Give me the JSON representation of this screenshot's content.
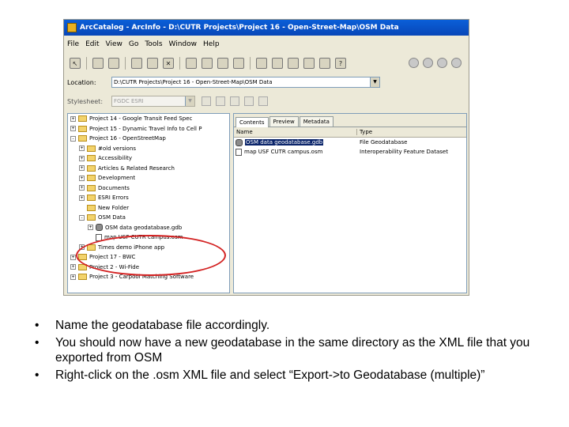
{
  "window": {
    "title": "ArcCatalog - ArcInfo - D:\\CUTR Projects\\Project 16 - Open-Street-Map\\OSM Data"
  },
  "menu": [
    "File",
    "Edit",
    "View",
    "Go",
    "Tools",
    "Window",
    "Help"
  ],
  "location": {
    "label": "Location:",
    "value": "D:\\CUTR Projects\\Project 16 - Open-Street-Map\\OSM Data"
  },
  "stylesheet": {
    "label": "Stylesheet:",
    "value": "FGDC ESRI"
  },
  "tree": [
    {
      "expander": "+",
      "icon": "folder",
      "label": "Project 14 - Google Transit Feed Spec",
      "indent": 0
    },
    {
      "expander": "+",
      "icon": "folder",
      "label": "Project 15 - Dynamic Travel Info to Cell P",
      "indent": 0
    },
    {
      "expander": "-",
      "icon": "folder",
      "label": "Project 16 - OpenStreetMap",
      "indent": 0
    },
    {
      "expander": "+",
      "icon": "folder",
      "label": "#old versions",
      "indent": 1
    },
    {
      "expander": "+",
      "icon": "folder",
      "label": "Accessibility",
      "indent": 1
    },
    {
      "expander": "+",
      "icon": "folder",
      "label": "Articles & Related Research",
      "indent": 1
    },
    {
      "expander": "+",
      "icon": "folder",
      "label": "Development",
      "indent": 1
    },
    {
      "expander": "+",
      "icon": "folder",
      "label": "Documents",
      "indent": 1
    },
    {
      "expander": "+",
      "icon": "folder",
      "label": "ESRI Errors",
      "indent": 1
    },
    {
      "expander": "",
      "icon": "folder",
      "label": "New Folder",
      "indent": 1
    },
    {
      "expander": "-",
      "icon": "folder",
      "label": "OSM Data",
      "indent": 1
    },
    {
      "expander": "+",
      "icon": "gdb",
      "label": "OSM data geodatabase.gdb",
      "indent": 2
    },
    {
      "expander": "",
      "icon": "osm",
      "label": "map USF CUTR campus.osm",
      "indent": 2
    },
    {
      "expander": "+",
      "icon": "folder",
      "label": "Times demo iPhone app",
      "indent": 1
    },
    {
      "expander": "+",
      "icon": "folder",
      "label": "Project 17 - BWC",
      "indent": 0
    },
    {
      "expander": "+",
      "icon": "folder",
      "label": "Project 2 - Wi-Fide",
      "indent": 0
    },
    {
      "expander": "+",
      "icon": "folder",
      "label": "Project 3 - Carpool Matching Software",
      "indent": 0
    }
  ],
  "tabs": [
    "Contents",
    "Preview",
    "Metadata"
  ],
  "contents": {
    "columns": [
      "Name",
      "Type"
    ],
    "rows": [
      {
        "name": "OSM data geodatabase.gdb",
        "type": "File Geodatabase",
        "icon": "gdb",
        "selected": true
      },
      {
        "name": "map USF CUTR campus.osm",
        "type": "Interoperability Feature Dataset",
        "icon": "osm",
        "selected": false
      }
    ]
  },
  "bullets": [
    "Name the geodatabase file accordingly.",
    "You should now have a new geodatabase in the same directory as the XML file that you exported from OSM",
    "Right-click on the .osm XML file and select “Export->to Geodatabase (multiple)”"
  ],
  "bullet_symbol": "•",
  "colors": {
    "titlebar": "#0a5fd8",
    "selection": "#0a246a",
    "highlight_oval": "#d32222",
    "window_bg": "#ece9d8"
  }
}
